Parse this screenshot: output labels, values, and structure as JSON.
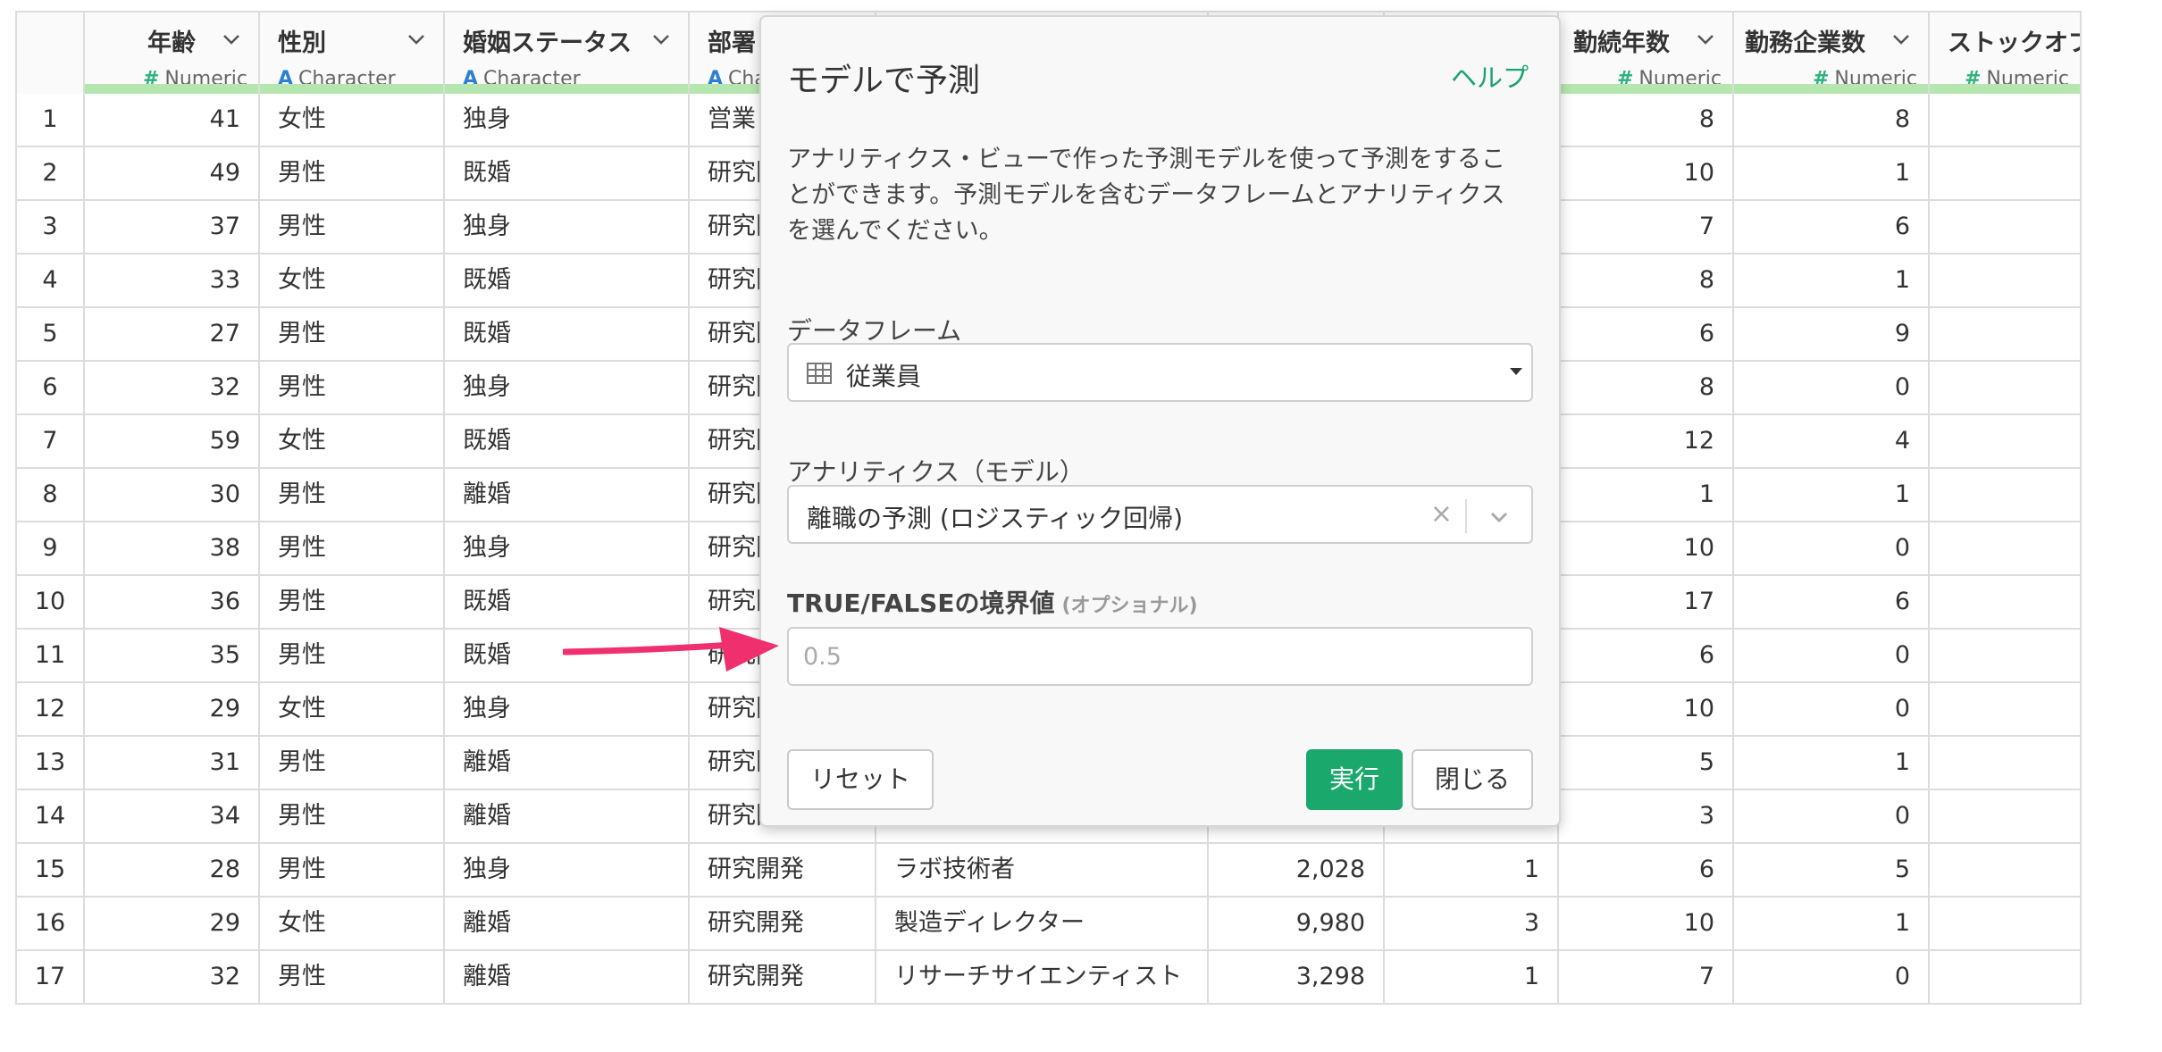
{
  "columns": [
    {
      "name": "",
      "type": "",
      "kind": "index"
    },
    {
      "name": "年齢",
      "type": "Numeric",
      "kind": "num"
    },
    {
      "name": "性別",
      "type": "Character",
      "kind": "chr"
    },
    {
      "name": "婚姻ステータス",
      "type": "Character",
      "kind": "chr"
    },
    {
      "name": "部署",
      "type": "Character",
      "kind": "chr"
    },
    {
      "name": "",
      "type": "",
      "kind": "hidden"
    },
    {
      "name": "",
      "type": "",
      "kind": "hidden"
    },
    {
      "name": "",
      "type": "",
      "kind": "hidden"
    },
    {
      "name": "勤続年数",
      "type": "Numeric",
      "kind": "num"
    },
    {
      "name": "勤務企業数",
      "type": "Numeric",
      "kind": "num"
    },
    {
      "name": "ストックオプション",
      "type": "Numeric",
      "kind": "num"
    }
  ],
  "rows": [
    [
      "1",
      "41",
      "女性",
      "独身",
      "営業",
      "",
      "",
      "",
      "8",
      "8",
      ""
    ],
    [
      "2",
      "49",
      "男性",
      "既婚",
      "研究開発",
      "",
      "",
      "",
      "10",
      "1",
      ""
    ],
    [
      "3",
      "37",
      "男性",
      "独身",
      "研究開発",
      "",
      "",
      "",
      "7",
      "6",
      ""
    ],
    [
      "4",
      "33",
      "女性",
      "既婚",
      "研究開発",
      "",
      "",
      "",
      "8",
      "1",
      ""
    ],
    [
      "5",
      "27",
      "男性",
      "既婚",
      "研究開発",
      "",
      "",
      "",
      "6",
      "9",
      ""
    ],
    [
      "6",
      "32",
      "男性",
      "独身",
      "研究開発",
      "",
      "",
      "",
      "8",
      "0",
      ""
    ],
    [
      "7",
      "59",
      "女性",
      "既婚",
      "研究開発",
      "",
      "",
      "",
      "12",
      "4",
      ""
    ],
    [
      "8",
      "30",
      "男性",
      "離婚",
      "研究開発",
      "",
      "",
      "",
      "1",
      "1",
      ""
    ],
    [
      "9",
      "38",
      "男性",
      "独身",
      "研究開発",
      "",
      "",
      "",
      "10",
      "0",
      ""
    ],
    [
      "10",
      "36",
      "男性",
      "既婚",
      "研究開発",
      "",
      "",
      "",
      "17",
      "6",
      ""
    ],
    [
      "11",
      "35",
      "男性",
      "既婚",
      "研究開発",
      "",
      "",
      "",
      "6",
      "0",
      ""
    ],
    [
      "12",
      "29",
      "女性",
      "独身",
      "研究開発",
      "",
      "",
      "",
      "10",
      "0",
      ""
    ],
    [
      "13",
      "31",
      "男性",
      "離婚",
      "研究開発",
      "",
      "",
      "",
      "5",
      "1",
      ""
    ],
    [
      "14",
      "34",
      "男性",
      "離婚",
      "研究開発",
      "",
      "",
      "",
      "3",
      "0",
      ""
    ],
    [
      "15",
      "28",
      "男性",
      "独身",
      "研究開発",
      "ラボ技術者",
      "2,028",
      "1",
      "6",
      "5",
      ""
    ],
    [
      "16",
      "29",
      "女性",
      "離婚",
      "研究開発",
      "製造ディレクター",
      "9,980",
      "3",
      "10",
      "1",
      ""
    ],
    [
      "17",
      "32",
      "男性",
      "離婚",
      "研究開発",
      "リサーチサイエンティスト",
      "3,298",
      "1",
      "7",
      "0",
      ""
    ]
  ],
  "modal": {
    "title": "モデルで予測",
    "help": "ヘルプ",
    "description": "アナリティクス・ビューで作った予測モデルを使って予測をすることができます。予測モデルを含むデータフレームとアナリティクスを選んでください。",
    "dataframe_label": "データフレーム",
    "dataframe_value": "従業員",
    "analytics_label": "アナリティクス（モデル）",
    "analytics_value": "離職の予測 (ロジスティック回帰)",
    "threshold_label": "TRUE/FALSEの境界値",
    "threshold_optional": "(オプショナル)",
    "threshold_placeholder": "0.5",
    "reset_label": "リセット",
    "run_label": "実行",
    "close_label": "閉じる"
  },
  "colors": {
    "accent_green": "#1aa86c",
    "numeric_type": "#2bb27d",
    "character_type": "#2b7fd6",
    "annotation_arrow": "#f0306e"
  }
}
